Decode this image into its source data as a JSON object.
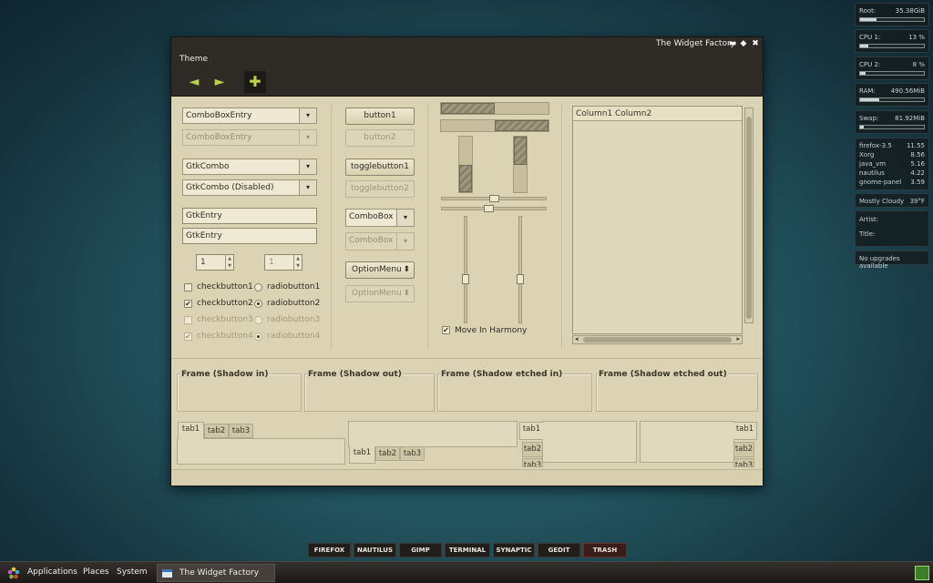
{
  "window": {
    "title": "The Widget Factory",
    "menu": [
      "Theme"
    ],
    "controls": {
      "minimize": "▬",
      "maximize": "◆",
      "close": "✖"
    }
  },
  "toolbar": {
    "back": "◄",
    "forward": "►",
    "add": "✚"
  },
  "combos": {
    "entry1": "ComboBoxEntry",
    "entry2": "ComboBoxEntry",
    "gtk1": "GtkCombo",
    "gtk2": "GtkCombo (Disabled)",
    "arrow": "▾"
  },
  "entries": {
    "e1": "GtkEntry",
    "e2": "GtkEntry"
  },
  "spins": {
    "s1": "1",
    "s2": "1",
    "up": "▲",
    "down": "▼"
  },
  "checks": [
    {
      "check": "checkbutton1",
      "radio": "radiobutton1",
      "checked": false,
      "selected": false,
      "disabled": false
    },
    {
      "check": "checkbutton2",
      "radio": "radiobutton2",
      "checked": true,
      "selected": true,
      "disabled": false
    },
    {
      "check": "checkbutton3",
      "radio": "radiobutton3",
      "checked": false,
      "selected": false,
      "disabled": true
    },
    {
      "check": "checkbutton4",
      "radio": "radiobutton4",
      "checked": true,
      "selected": true,
      "disabled": true
    }
  ],
  "check_mark": "✔",
  "buttons": {
    "b1": "button1",
    "b2": "button2",
    "t1": "togglebutton1",
    "t2": "togglebutton2",
    "cb1": "ComboBox",
    "cb2": "ComboBox",
    "om1": "OptionMenu",
    "om2": "OptionMenu",
    "om_arrow": "⬍"
  },
  "progress": {
    "h1": 0.5,
    "h2": 0.5,
    "v1": 0.5,
    "v2": 0.5
  },
  "scales": {
    "h1": 0.5,
    "h2": 0.45,
    "v1": 0.6,
    "v2": 0.6
  },
  "harmony": {
    "label": "Move In Harmony",
    "checked": true
  },
  "treeview": {
    "columns": [
      "Column1",
      "Column2"
    ],
    "scroll_left": "◂",
    "scroll_right": "▸"
  },
  "frames": [
    "Frame (Shadow in)",
    "Frame (Shadow out)",
    "Frame (Shadow etched in)",
    "Frame (Shadow etched out)"
  ],
  "notebooks": {
    "tabs": [
      "tab1",
      "tab2",
      "tab3"
    ]
  },
  "conky": {
    "root_label": "Root:",
    "root_value": "35.38GiB",
    "root_level": 0.25,
    "cpu1_label": "CPU 1:",
    "cpu1_value": "13 %",
    "cpu1_level": 0.13,
    "cpu2_label": "CPU 2:",
    "cpu2_value": "8 %",
    "cpu2_level": 0.08,
    "ram_label": "RAM:",
    "ram_value": "490.56MiB",
    "ram_level": 0.3,
    "swap_label": "Swap:",
    "swap_value": "81.92MiB",
    "swap_level": 0.05,
    "procs": [
      {
        "name": "firefox-3.5",
        "val": "11.55"
      },
      {
        "name": "Xorg",
        "val": "8.56"
      },
      {
        "name": "java_vm",
        "val": "5.16"
      },
      {
        "name": "nautilus",
        "val": "4.22"
      },
      {
        "name": "gnome-panel",
        "val": "3.59"
      }
    ],
    "weather": "Mostly Cloudy",
    "temp": "39°F",
    "artist": "Artist:",
    "title": "Title:",
    "upgrades": "No upgrades available"
  },
  "dock": [
    "FIREFOX",
    "NAUTILUS",
    "GIMP",
    "TERMINAL",
    "SYNAPTIC",
    "GEDIT",
    "TRASH"
  ],
  "panel": {
    "applications": "Applications",
    "places": "Places",
    "system": "System",
    "task": "The Widget Factory"
  },
  "colors": {
    "accent": "#b9d24a",
    "window_bg": "#dcd3b4",
    "titlebar": "#2e2a26",
    "trash": "#c43a2b"
  }
}
